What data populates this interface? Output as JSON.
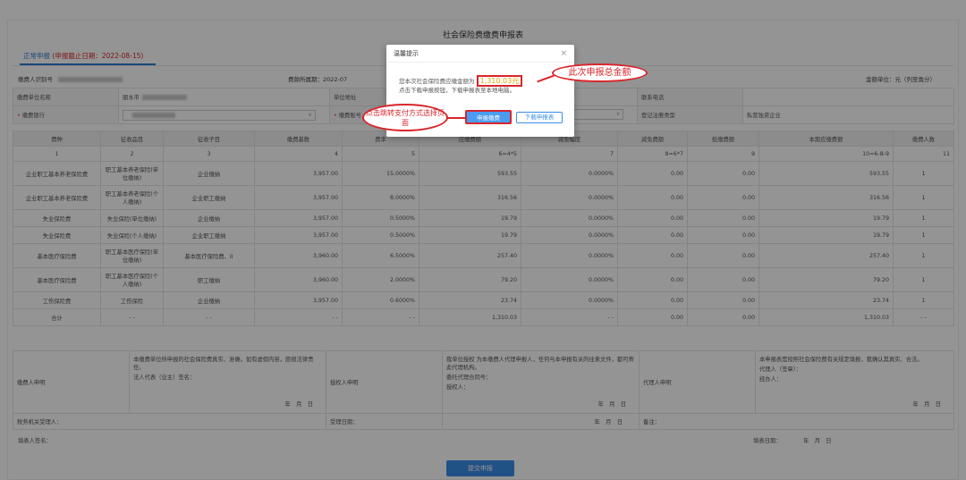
{
  "page": {
    "title": "社会保险费缴费申报表",
    "tab_label": "正常申报",
    "tab_deadline": "(申报截止日期：2022-08-15)",
    "payer_id_label": "缴费人识别号",
    "period_label": "费款所属期：2022-07",
    "unit_label": "金额单位：元（列至角分）"
  },
  "info_grid": {
    "unit_name_label": "缴费单位名称",
    "unit_name_value": "丽水市",
    "address_label": "单位地址",
    "phone_label": "联系电话",
    "bank_label": "缴费银行",
    "account_label": "缴费账号",
    "reg_type_label": "登记注册类型",
    "reg_type_value": "私营独资企业"
  },
  "table": {
    "headers": [
      "费种",
      "征收品目",
      "征收子目",
      "缴费基数",
      "费率",
      "应缴费额",
      "减免幅度",
      "减免费额",
      "抵缴费额",
      "本期应缴费额",
      "缴费人数"
    ],
    "col_numbers": [
      "1",
      "2",
      "3",
      "4",
      "5",
      "6=4*5",
      "7",
      "8=6*7",
      "9",
      "10=6-8-9",
      "11"
    ],
    "rows": [
      {
        "type": "企业职工基本养老保险费",
        "item": "职工基本养老保险(单位缴纳)",
        "sub": "企业缴纳",
        "base": "3,957.00",
        "rate": "15.0000%",
        "due": "593.55",
        "relief_rate": "0.0000%",
        "relief": "0.00",
        "offset": "0.00",
        "current": "593.55",
        "count": "1"
      },
      {
        "type": "企业职工基本养老保险费",
        "item": "职工基本养老保险(个人缴纳)",
        "sub": "企业职工缴纳",
        "base": "3,957.00",
        "rate": "8.0000%",
        "due": "316.56",
        "relief_rate": "0.0000%",
        "relief": "0.00",
        "offset": "0.00",
        "current": "316.56",
        "count": "1"
      },
      {
        "type": "失业保险费",
        "item": "失业保险(单位缴纳)",
        "sub": "企业缴纳",
        "base": "3,957.00",
        "rate": "0.5000%",
        "due": "19.79",
        "relief_rate": "0.0000%",
        "relief": "0.00",
        "offset": "0.00",
        "current": "19.79",
        "count": "1"
      },
      {
        "type": "失业保险费",
        "item": "失业保险(个人缴纳)",
        "sub": "企业职工缴纳",
        "base": "3,957.00",
        "rate": "0.5000%",
        "due": "19.79",
        "relief_rate": "0.0000%",
        "relief": "0.00",
        "offset": "0.00",
        "current": "19.79",
        "count": "1"
      },
      {
        "type": "基本医疗保险费",
        "item": "职工基本医疗保险(单位缴纳)",
        "sub": "基本医疗保险费、II",
        "base": "3,960.00",
        "rate": "6.5000%",
        "due": "257.40",
        "relief_rate": "0.0000%",
        "relief": "0.00",
        "offset": "0.00",
        "current": "257.40",
        "count": "1"
      },
      {
        "type": "基本医疗保险费",
        "item": "职工基本医疗保险(个人缴纳)",
        "sub": "职工缴纳",
        "base": "3,960.00",
        "rate": "2.0000%",
        "due": "79.20",
        "relief_rate": "0.0000%",
        "relief": "0.00",
        "offset": "0.00",
        "current": "79.20",
        "count": "1"
      },
      {
        "type": "工伤保险费",
        "item": "工伤保险",
        "sub": "企业缴纳",
        "base": "3,957.00",
        "rate": "0.6000%",
        "due": "23.74",
        "relief_rate": "0.0000%",
        "relief": "0.00",
        "offset": "0.00",
        "current": "23.74",
        "count": "1"
      }
    ],
    "total": {
      "type": "合计",
      "item": "- -",
      "sub": "- -",
      "base": "- -",
      "rate": "- -",
      "due": "1,310.03",
      "relief_rate": "- -",
      "relief": "0.00",
      "offset": "0.00",
      "current": "1,310.03",
      "count": "- -"
    }
  },
  "declaration": {
    "payer_decl_label": "缴费人申明",
    "payer_decl_text": "本缴费单位所申报的社会保险费真实、准确，如有虚假内容，愿担法律责任。",
    "legal_rep": "法人代表（业主）签名：",
    "date_ymd": "年　月　日",
    "auth_decl_label": "授权人申明",
    "auth_text": "我单位授权 为本缴费人代理申报人，任何与本申报有关的往来文件，都可寄此代理机构。",
    "auth_contract": "委托代理合同号：",
    "auth_person": "授权人：",
    "agent_decl_label": "代理人申明",
    "agent_text": "本申报表是按照社会保险费有关规定填报，我确认其真实、合法。",
    "agent_sign": "代理人（签章）：",
    "handler": "经办人："
  },
  "bottom": {
    "tax_officer": "税务机关受理人：",
    "accept_date": "受理日期：",
    "remark": "备注：",
    "filler_sign": "填表人签名：",
    "fill_date": "填表日期：",
    "fill_date_ymd": "年　月　日",
    "submit": "提交申报"
  },
  "modal": {
    "title": "温馨提示",
    "close": "×",
    "msg_prefix": "您本次社会保险费应缴金额为",
    "amount": "1,310.03元",
    "msg_line2": "点击下载申报按钮，下载申报表至本地电脑。",
    "btn_primary": "申报缴费",
    "btn_download": "下载申报表"
  },
  "annotations": {
    "callout_total": "此次申报总金额",
    "callout_pay": "点击跳转支付方式选择页面"
  }
}
